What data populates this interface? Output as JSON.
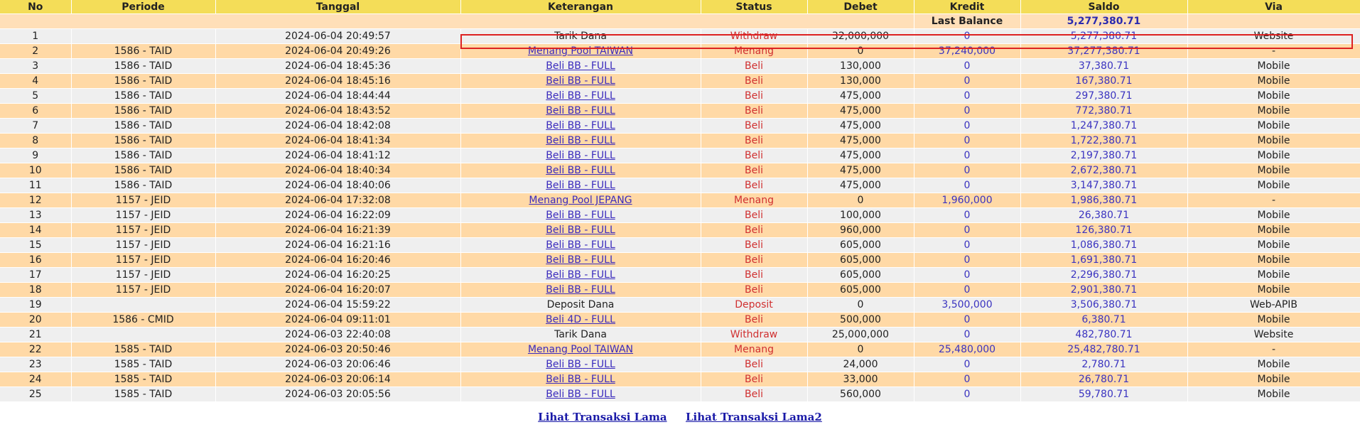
{
  "header": {
    "no": "No",
    "periode": "Periode",
    "tanggal": "Tanggal",
    "keterangan": "Keterangan",
    "status": "Status",
    "debet": "Debet",
    "kredit": "Kredit",
    "saldo": "Saldo",
    "via": "Via"
  },
  "last_balance": {
    "label": "Last Balance",
    "value": "5,277,380.71"
  },
  "rows": [
    {
      "no": "1",
      "periode": "",
      "tanggal": "2024-06-04 20:49:57",
      "ket": "Tarik Dana",
      "link": false,
      "status": "Withdraw",
      "debet": "32,000,000",
      "kredit": "0",
      "saldo": "5,277,380.71",
      "via": "Website"
    },
    {
      "no": "2",
      "periode": "1586 - TAID",
      "tanggal": "2024-06-04 20:49:26",
      "ket": "Menang Pool TAIWAN",
      "link": true,
      "status": "Menang",
      "debet": "0",
      "kredit": "37,240,000",
      "saldo": "37,277,380.71",
      "via": "-"
    },
    {
      "no": "3",
      "periode": "1586 - TAID",
      "tanggal": "2024-06-04 18:45:36",
      "ket": "Beli BB - FULL",
      "link": true,
      "status": "Beli",
      "debet": "130,000",
      "kredit": "0",
      "saldo": "37,380.71",
      "via": "Mobile"
    },
    {
      "no": "4",
      "periode": "1586 - TAID",
      "tanggal": "2024-06-04 18:45:16",
      "ket": "Beli BB - FULL",
      "link": true,
      "status": "Beli",
      "debet": "130,000",
      "kredit": "0",
      "saldo": "167,380.71",
      "via": "Mobile"
    },
    {
      "no": "5",
      "periode": "1586 - TAID",
      "tanggal": "2024-06-04 18:44:44",
      "ket": "Beli BB - FULL",
      "link": true,
      "status": "Beli",
      "debet": "475,000",
      "kredit": "0",
      "saldo": "297,380.71",
      "via": "Mobile"
    },
    {
      "no": "6",
      "periode": "1586 - TAID",
      "tanggal": "2024-06-04 18:43:52",
      "ket": "Beli BB - FULL",
      "link": true,
      "status": "Beli",
      "debet": "475,000",
      "kredit": "0",
      "saldo": "772,380.71",
      "via": "Mobile"
    },
    {
      "no": "7",
      "periode": "1586 - TAID",
      "tanggal": "2024-06-04 18:42:08",
      "ket": "Beli BB - FULL",
      "link": true,
      "status": "Beli",
      "debet": "475,000",
      "kredit": "0",
      "saldo": "1,247,380.71",
      "via": "Mobile"
    },
    {
      "no": "8",
      "periode": "1586 - TAID",
      "tanggal": "2024-06-04 18:41:34",
      "ket": "Beli BB - FULL",
      "link": true,
      "status": "Beli",
      "debet": "475,000",
      "kredit": "0",
      "saldo": "1,722,380.71",
      "via": "Mobile"
    },
    {
      "no": "9",
      "periode": "1586 - TAID",
      "tanggal": "2024-06-04 18:41:12",
      "ket": "Beli BB - FULL",
      "link": true,
      "status": "Beli",
      "debet": "475,000",
      "kredit": "0",
      "saldo": "2,197,380.71",
      "via": "Mobile"
    },
    {
      "no": "10",
      "periode": "1586 - TAID",
      "tanggal": "2024-06-04 18:40:34",
      "ket": "Beli BB - FULL",
      "link": true,
      "status": "Beli",
      "debet": "475,000",
      "kredit": "0",
      "saldo": "2,672,380.71",
      "via": "Mobile"
    },
    {
      "no": "11",
      "periode": "1586 - TAID",
      "tanggal": "2024-06-04 18:40:06",
      "ket": "Beli BB - FULL",
      "link": true,
      "status": "Beli",
      "debet": "475,000",
      "kredit": "0",
      "saldo": "3,147,380.71",
      "via": "Mobile"
    },
    {
      "no": "12",
      "periode": "1157 - JEID",
      "tanggal": "2024-06-04 17:32:08",
      "ket": "Menang Pool JEPANG",
      "link": true,
      "status": "Menang",
      "debet": "0",
      "kredit": "1,960,000",
      "saldo": "1,986,380.71",
      "via": "-"
    },
    {
      "no": "13",
      "periode": "1157 - JEID",
      "tanggal": "2024-06-04 16:22:09",
      "ket": "Beli BB - FULL",
      "link": true,
      "status": "Beli",
      "debet": "100,000",
      "kredit": "0",
      "saldo": "26,380.71",
      "via": "Mobile"
    },
    {
      "no": "14",
      "periode": "1157 - JEID",
      "tanggal": "2024-06-04 16:21:39",
      "ket": "Beli BB - FULL",
      "link": true,
      "status": "Beli",
      "debet": "960,000",
      "kredit": "0",
      "saldo": "126,380.71",
      "via": "Mobile"
    },
    {
      "no": "15",
      "periode": "1157 - JEID",
      "tanggal": "2024-06-04 16:21:16",
      "ket": "Beli BB - FULL",
      "link": true,
      "status": "Beli",
      "debet": "605,000",
      "kredit": "0",
      "saldo": "1,086,380.71",
      "via": "Mobile"
    },
    {
      "no": "16",
      "periode": "1157 - JEID",
      "tanggal": "2024-06-04 16:20:46",
      "ket": "Beli BB - FULL",
      "link": true,
      "status": "Beli",
      "debet": "605,000",
      "kredit": "0",
      "saldo": "1,691,380.71",
      "via": "Mobile"
    },
    {
      "no": "17",
      "periode": "1157 - JEID",
      "tanggal": "2024-06-04 16:20:25",
      "ket": "Beli BB - FULL",
      "link": true,
      "status": "Beli",
      "debet": "605,000",
      "kredit": "0",
      "saldo": "2,296,380.71",
      "via": "Mobile"
    },
    {
      "no": "18",
      "periode": "1157 - JEID",
      "tanggal": "2024-06-04 16:20:07",
      "ket": "Beli BB - FULL",
      "link": true,
      "status": "Beli",
      "debet": "605,000",
      "kredit": "0",
      "saldo": "2,901,380.71",
      "via": "Mobile"
    },
    {
      "no": "19",
      "periode": "",
      "tanggal": "2024-06-04 15:59:22",
      "ket": "Deposit Dana",
      "link": false,
      "status": "Deposit",
      "debet": "0",
      "kredit": "3,500,000",
      "saldo": "3,506,380.71",
      "via": "Web-APIB"
    },
    {
      "no": "20",
      "periode": "1586 - CMID",
      "tanggal": "2024-06-04 09:11:01",
      "ket": "Beli 4D - FULL",
      "link": true,
      "status": "Beli",
      "debet": "500,000",
      "kredit": "0",
      "saldo": "6,380.71",
      "via": "Mobile"
    },
    {
      "no": "21",
      "periode": "",
      "tanggal": "2024-06-03 22:40:08",
      "ket": "Tarik Dana",
      "link": false,
      "status": "Withdraw",
      "debet": "25,000,000",
      "kredit": "0",
      "saldo": "482,780.71",
      "via": "Website"
    },
    {
      "no": "22",
      "periode": "1585 - TAID",
      "tanggal": "2024-06-03 20:50:46",
      "ket": "Menang Pool TAIWAN",
      "link": true,
      "status": "Menang",
      "debet": "0",
      "kredit": "25,480,000",
      "saldo": "25,482,780.71",
      "via": "-"
    },
    {
      "no": "23",
      "periode": "1585 - TAID",
      "tanggal": "2024-06-03 20:06:46",
      "ket": "Beli BB - FULL",
      "link": true,
      "status": "Beli",
      "debet": "24,000",
      "kredit": "0",
      "saldo": "2,780.71",
      "via": "Mobile"
    },
    {
      "no": "24",
      "periode": "1585 - TAID",
      "tanggal": "2024-06-03 20:06:14",
      "ket": "Beli BB - FULL",
      "link": true,
      "status": "Beli",
      "debet": "33,000",
      "kredit": "0",
      "saldo": "26,780.71",
      "via": "Mobile"
    },
    {
      "no": "25",
      "periode": "1585 - TAID",
      "tanggal": "2024-06-03 20:05:56",
      "ket": "Beli BB - FULL",
      "link": true,
      "status": "Beli",
      "debet": "560,000",
      "kredit": "0",
      "saldo": "59,780.71",
      "via": "Mobile"
    }
  ],
  "footer": {
    "link1": "Lihat Transaksi Lama",
    "link2": "Lihat Transaksi Lama2"
  },
  "colors": {
    "header_bg": "#f4dd58",
    "row_odd": "#efefef",
    "row_even": "#ffd9a6",
    "status_red": "#d03030",
    "value_blue": "#3a33c0",
    "selection_border": "#dd2222"
  }
}
